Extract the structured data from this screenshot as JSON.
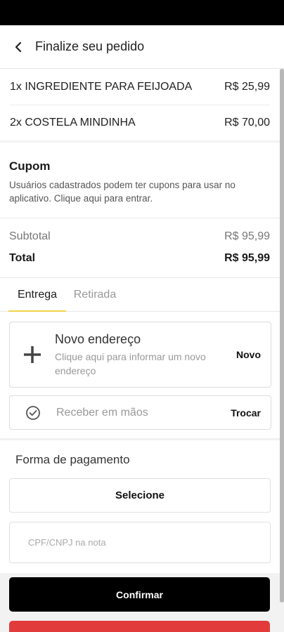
{
  "header": {
    "title": "Finalize seu pedido",
    "back_icon": "chevron-left-icon"
  },
  "order_items": [
    {
      "label": "1x INGREDIENTE PARA FEIJOADA",
      "price": "R$ 25,99"
    },
    {
      "label": "2x COSTELA MINDINHA",
      "price": "R$ 70,00"
    }
  ],
  "coupon": {
    "title": "Cupom",
    "text": "Usuários cadastrados podem ter cupons para usar no aplicativo. Clique aqui para entrar."
  },
  "totals": {
    "subtotal_label": "Subtotal",
    "subtotal_value": "R$ 95,99",
    "total_label": "Total",
    "total_value": "R$ 95,99"
  },
  "tabs": [
    {
      "label": "Entrega",
      "active": true
    },
    {
      "label": "Retirada",
      "active": false
    }
  ],
  "address": {
    "icon": "plus-icon",
    "title": "Novo endereço",
    "subtitle": "Clique aqui para informar um novo endereço",
    "action": "Novo"
  },
  "receive": {
    "icon": "check-circle-icon",
    "label": "Receber em mãos",
    "action": "Trocar"
  },
  "payment": {
    "title": "Forma de pagamento",
    "select_label": "Selecione",
    "cpf_placeholder": "CPF/CNPJ na nota",
    "cpf_value": ""
  },
  "confirm_label": "Confirmar",
  "colors": {
    "accent": "#f3d34a",
    "confirm_bg": "#000000",
    "danger": "#e23b3b"
  }
}
